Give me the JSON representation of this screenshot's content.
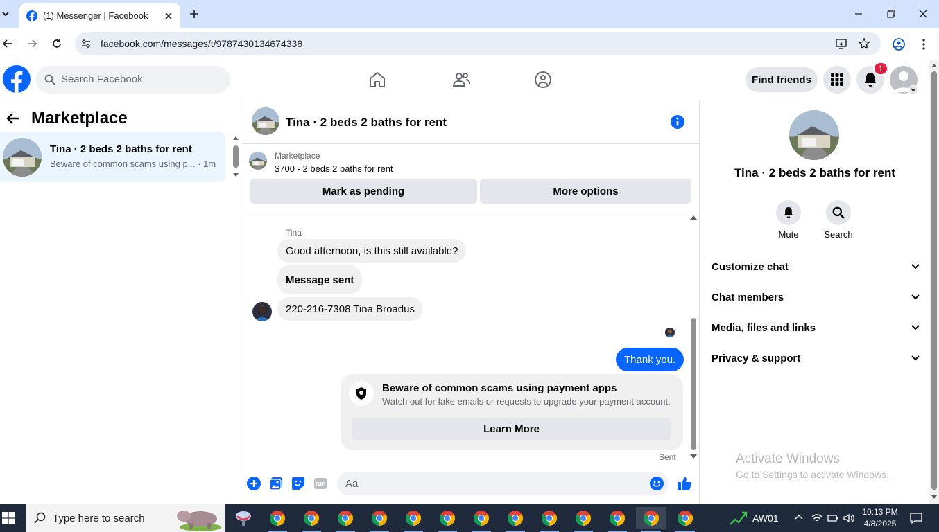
{
  "browser": {
    "tab_title": "(1) Messenger | Facebook",
    "url": "facebook.com/messages/t/9787430134674338"
  },
  "fb_header": {
    "search_placeholder": "Search Facebook",
    "find_friends": "Find friends",
    "notification_count": "1"
  },
  "left_panel": {
    "title": "Marketplace",
    "thread": {
      "name": "Tina · 2 beds 2 baths for rent",
      "preview": "Beware of common scams using p...",
      "time": " · 1m"
    }
  },
  "chat": {
    "header_title": "Tina · 2 beds 2 baths for rent",
    "listing": {
      "category": "Marketplace",
      "price_line": "$700 - 2 beds 2 baths for rent",
      "mark_pending": "Mark as pending",
      "more_options": "More options"
    },
    "messages": {
      "sender": "Tina",
      "msg1": "Good afternoon, is this still available?",
      "msg2": "Message sent",
      "msg3": "220-216-7308 Tina Broadus",
      "reply": "Thank you."
    },
    "scam_card": {
      "title": "Beware of common scams using payment apps",
      "subtitle": "Watch out for fake emails or requests to upgrade your payment account.",
      "button": "Learn More"
    },
    "sent_status": "Sent",
    "composer_placeholder": "Aa"
  },
  "right_panel": {
    "name": "Tina · 2 beds 2 baths for rent",
    "mute": "Mute",
    "search": "Search",
    "sections": [
      "Customize chat",
      "Chat members",
      "Media, files and links",
      "Privacy & support"
    ]
  },
  "watermark": {
    "line1": "Activate Windows",
    "line2": "Go to Settings to activate Windows."
  },
  "taskbar": {
    "search_placeholder": "Type here to search",
    "network_label": "AW01",
    "time": "10:13 PM",
    "date": "4/8/2025"
  },
  "colors": {
    "fb_blue": "#0866ff",
    "tab_strip": "#d3e3fd",
    "taskbar": "#1f2a3c"
  }
}
